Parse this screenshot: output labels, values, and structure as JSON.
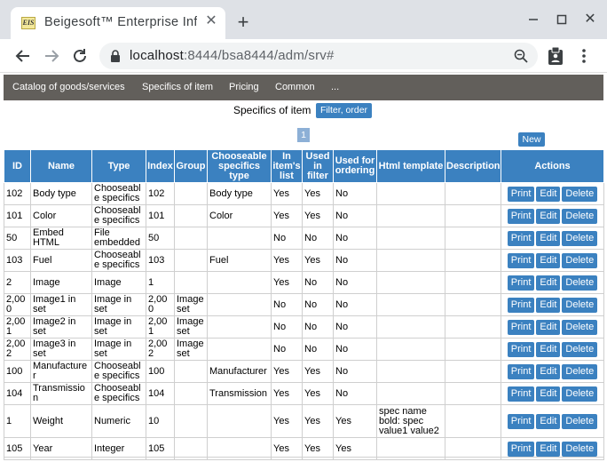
{
  "browser": {
    "tab_title": "Beigesoft™ Enterprise Information System",
    "favicon_text": "EIS",
    "url_host": "localhost",
    "url_rest": ":8444/bsa8444/adm/srv#"
  },
  "nav": {
    "items": [
      "Catalog of goods/services",
      "Specifics of item",
      "Pricing",
      "Common",
      "..."
    ]
  },
  "page": {
    "title": "Specifics of item",
    "filter_label": "Filter, order",
    "page_number": "1",
    "new_label": "New"
  },
  "table": {
    "headers": [
      "ID",
      "Name",
      "Type",
      "Index",
      "Group",
      "Chooseable specifics type",
      "In item's list",
      "Used in filter",
      "Used for ordering",
      "Html template",
      "Description",
      "Actions"
    ],
    "rows": [
      {
        "id": "102",
        "name": "Body type",
        "type": "Chooseable specifics",
        "index": "102",
        "group": "",
        "ctype": "Body type",
        "inlist": "Yes",
        "filter": "Yes",
        "ordering": "No",
        "html": "",
        "desc": ""
      },
      {
        "id": "101",
        "name": "Color",
        "type": "Chooseable specifics",
        "index": "101",
        "group": "",
        "ctype": "Color",
        "inlist": "Yes",
        "filter": "Yes",
        "ordering": "No",
        "html": "",
        "desc": ""
      },
      {
        "id": "50",
        "name": "Embed HTML",
        "type": "File embedded",
        "index": "50",
        "group": "",
        "ctype": "",
        "inlist": "No",
        "filter": "No",
        "ordering": "No",
        "html": "",
        "desc": ""
      },
      {
        "id": "103",
        "name": "Fuel",
        "type": "Chooseable specifics",
        "index": "103",
        "group": "",
        "ctype": "Fuel",
        "inlist": "Yes",
        "filter": "Yes",
        "ordering": "No",
        "html": "",
        "desc": ""
      },
      {
        "id": "2",
        "name": "Image",
        "type": "Image",
        "index": "1",
        "group": "",
        "ctype": "",
        "inlist": "Yes",
        "filter": "No",
        "ordering": "No",
        "html": "",
        "desc": ""
      },
      {
        "id": "2,000",
        "name": "Image1 in set",
        "type": "Image in set",
        "index": "2,000",
        "group": "Image set",
        "ctype": "",
        "inlist": "No",
        "filter": "No",
        "ordering": "No",
        "html": "",
        "desc": ""
      },
      {
        "id": "2,001",
        "name": "Image2 in set",
        "type": "Image in set",
        "index": "2,001",
        "group": "Image set",
        "ctype": "",
        "inlist": "No",
        "filter": "No",
        "ordering": "No",
        "html": "",
        "desc": ""
      },
      {
        "id": "2,002",
        "name": "Image3 in set",
        "type": "Image in set",
        "index": "2,002",
        "group": "Image set",
        "ctype": "",
        "inlist": "No",
        "filter": "No",
        "ordering": "No",
        "html": "",
        "desc": ""
      },
      {
        "id": "100",
        "name": "Manufacturer",
        "type": "Chooseable specifics",
        "index": "100",
        "group": "",
        "ctype": "Manufacturer",
        "inlist": "Yes",
        "filter": "Yes",
        "ordering": "No",
        "html": "",
        "desc": ""
      },
      {
        "id": "104",
        "name": "Transmission",
        "type": "Chooseable specifics",
        "index": "104",
        "group": "",
        "ctype": "Transmission",
        "inlist": "Yes",
        "filter": "Yes",
        "ordering": "No",
        "html": "",
        "desc": ""
      },
      {
        "id": "1",
        "name": "Weight",
        "type": "Numeric",
        "index": "10",
        "group": "",
        "ctype": "",
        "inlist": "Yes",
        "filter": "Yes",
        "ordering": "Yes",
        "html": "spec name bold: spec value1 value2",
        "desc": ""
      },
      {
        "id": "105",
        "name": "Year",
        "type": "Integer",
        "index": "105",
        "group": "",
        "ctype": "",
        "inlist": "Yes",
        "filter": "Yes",
        "ordering": "Yes",
        "html": "",
        "desc": ""
      }
    ],
    "actions": {
      "print": "Print",
      "edit": "Edit",
      "delete": "Delete"
    }
  },
  "colors": {
    "accent": "#3b81c0",
    "nav_bg": "#625f5b",
    "page_badge": "#8db0d6"
  },
  "icons": [
    "back-arrow-icon",
    "forward-arrow-icon",
    "reload-icon",
    "lock-icon",
    "zoom-icon",
    "extension-icon",
    "menu-dots-icon",
    "close-icon",
    "plus-icon",
    "minimize-icon",
    "maximize-icon"
  ]
}
